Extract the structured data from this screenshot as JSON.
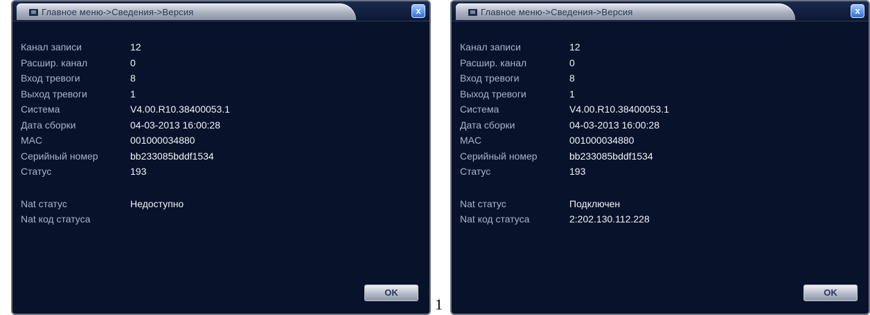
{
  "left_window": {
    "title": "Главное меню->Сведения->Версия",
    "close_label": "x",
    "ok_label": "OK",
    "rows": [
      {
        "label": "Канал записи",
        "value": "12"
      },
      {
        "label": "Расшир. канал",
        "value": "0"
      },
      {
        "label": "Вход тревоги",
        "value": "8"
      },
      {
        "label": "Выход тревоги",
        "value": "1"
      },
      {
        "label": "Система",
        "value": "V4.00.R10.38400053.1"
      },
      {
        "label": "Дата сборки",
        "value": "04-03-2013 16:00:28"
      },
      {
        "label": "MAC",
        "value": "001000034880"
      },
      {
        "label": "Серийный номер",
        "value": "bb233085bddf1534"
      },
      {
        "label": "Статус",
        "value": "193"
      }
    ],
    "nat_rows": [
      {
        "label": "Nat статус",
        "value": "Недоступно"
      },
      {
        "label": "Nat код статуса",
        "value": ""
      }
    ]
  },
  "separator_text": "1",
  "right_window": {
    "title": "Главное меню->Сведения->Версия",
    "close_label": "x",
    "ok_label": "OK",
    "rows": [
      {
        "label": "Канал записи",
        "value": "12"
      },
      {
        "label": "Расшир. канал",
        "value": "0"
      },
      {
        "label": "Вход тревоги",
        "value": "8"
      },
      {
        "label": "Выход тревоги",
        "value": "1"
      },
      {
        "label": "Система",
        "value": "V4.00.R10.38400053.1"
      },
      {
        "label": "Дата сборки",
        "value": "04-03-2013 16:00:28"
      },
      {
        "label": "MAC",
        "value": "001000034880"
      },
      {
        "label": "Серийный номер",
        "value": "bb233085bddf1534"
      },
      {
        "label": "Статус",
        "value": "193"
      }
    ],
    "nat_rows": [
      {
        "label": "Nat статус",
        "value": "Подключен"
      },
      {
        "label": "Nat код статуса",
        "value": "2:202.130.112.228"
      }
    ]
  },
  "colors": {
    "window_bg": "#08122a",
    "title_tab": "#a9b1c0",
    "close_button": "#2f6fd8",
    "label_text": "#aab4c8",
    "value_text": "#f0f4fb"
  },
  "icons": [
    "window-icon",
    "close-icon"
  ]
}
